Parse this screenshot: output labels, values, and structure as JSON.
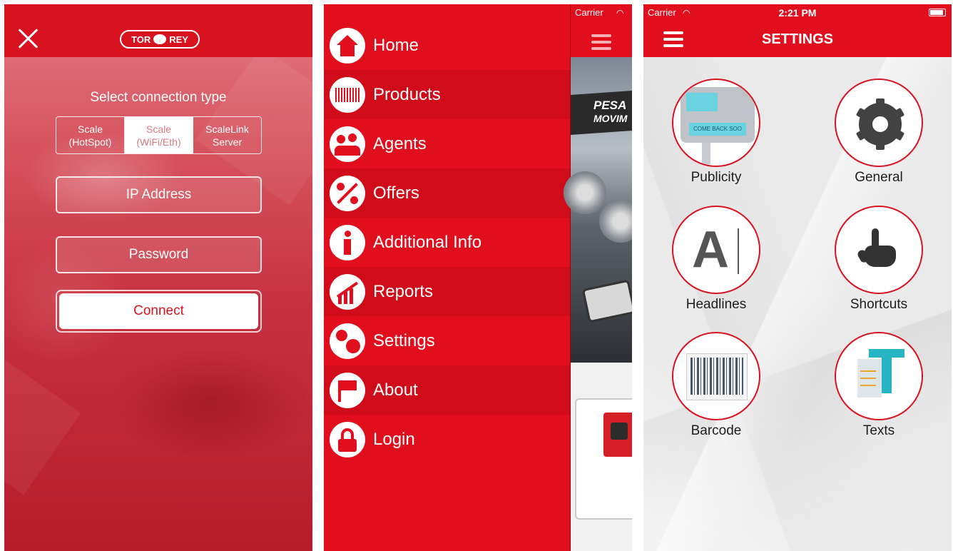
{
  "connection": {
    "title": "Select connection type",
    "logo_text": "TOR  REY",
    "segments": [
      {
        "line1": "Scale",
        "line2": "(HotSpot)"
      },
      {
        "line1": "Scale",
        "line2": "(WiFi/Eth)"
      },
      {
        "line1": "ScaleLink",
        "line2": "Server"
      }
    ],
    "selected_segment": "Scale (WiFi/Eth)",
    "ip_placeholder": "IP Address",
    "password_placeholder": "Password",
    "connect_label": "Connect"
  },
  "menu": {
    "status_carrier": "Carrier",
    "items": [
      {
        "label": "Home",
        "icon": "home-icon"
      },
      {
        "label": "Products",
        "icon": "barcode-scanner-icon"
      },
      {
        "label": "Agents",
        "icon": "agents-icon"
      },
      {
        "label": "Offers",
        "icon": "percent-icon"
      },
      {
        "label": "Additional Info",
        "icon": "info-icon"
      },
      {
        "label": "Reports",
        "icon": "reports-chart-icon"
      },
      {
        "label": "Settings",
        "icon": "settings-gears-icon"
      },
      {
        "label": "About",
        "icon": "flag-icon"
      },
      {
        "label": "Login",
        "icon": "lock-icon"
      }
    ],
    "banner_text_1": "PESA",
    "banner_text_2": "MOVIM"
  },
  "settings": {
    "status_carrier": "Carrier",
    "status_time": "2:21 PM",
    "title": "SETTINGS",
    "tiles": [
      {
        "label": "Publicity",
        "icon": "scale-display-icon"
      },
      {
        "label": "General",
        "icon": "gear-icon"
      },
      {
        "label": "Headlines",
        "icon": "headline-font-icon"
      },
      {
        "label": "Shortcuts",
        "icon": "touch-hand-icon"
      },
      {
        "label": "Barcode",
        "icon": "barcode-icon"
      },
      {
        "label": "Texts",
        "icon": "text-document-icon"
      }
    ],
    "scale_display_lcd": "COME BACK SOO",
    "headline_glyph": "A"
  },
  "colors": {
    "brand_red": "#e10f1e",
    "panel_bg": "#ececec"
  }
}
